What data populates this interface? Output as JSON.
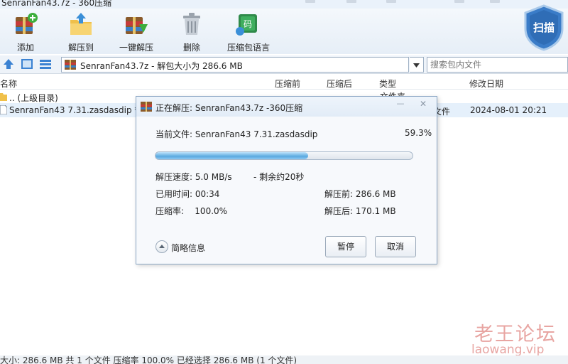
{
  "window": {
    "title": "SenranFan43.7z - 360压缩"
  },
  "toolbar": {
    "buttons": [
      {
        "label": "添加",
        "icon": "add-archive-icon"
      },
      {
        "label": "解压到",
        "icon": "extract-to-icon"
      },
      {
        "label": "一键解压",
        "icon": "one-click-extract-icon"
      },
      {
        "label": "删除",
        "icon": "trash-icon"
      },
      {
        "label": "压缩包语言",
        "icon": "archive-language-icon"
      }
    ],
    "scan_label": "扫描"
  },
  "address": {
    "path": "SenranFan43.7z - 解包大小为 286.6 MB",
    "dropdown_glyph": "V",
    "search_placeholder": "搜索包内文件"
  },
  "list": {
    "headers": {
      "name": "名称",
      "packed": "压缩前",
      "unpacked": "压缩后",
      "type": "类型",
      "modified": "修改日期"
    },
    "rows": [
      {
        "name": ".. (上级目录)",
        "type": "文件夹",
        "modified": ""
      },
      {
        "name": "SenranFan43 7.31.zasdasdip *",
        "type": "文件",
        "modified": "2024-08-01 20:21"
      }
    ]
  },
  "dialog": {
    "title": "正在解压: SenranFan43.7z -360压缩",
    "current_file_label": "当前文件: SenranFan43 7.31.zasdasdip",
    "percent": "59.3%",
    "progress": 0.593,
    "speed": "解压速度: 5.0 MB/s",
    "remaining": "- 剩余约20秒",
    "elapsed": "已用时间: 00:34",
    "ratio": "压缩率:    100.0%",
    "before": "解压前: 286.6 MB",
    "after": "解压后: 170.1 MB",
    "brief_label": "简略信息",
    "pause_label": "暂停",
    "cancel_label": "取消"
  },
  "status": {
    "text": "大小: 286.6 MB 共 1 个文件 压缩率 100.0% 已经选择 286.6 MB (1 个文件)"
  },
  "watermark": {
    "line1": "老王论坛",
    "line2": "laowang.vip"
  }
}
